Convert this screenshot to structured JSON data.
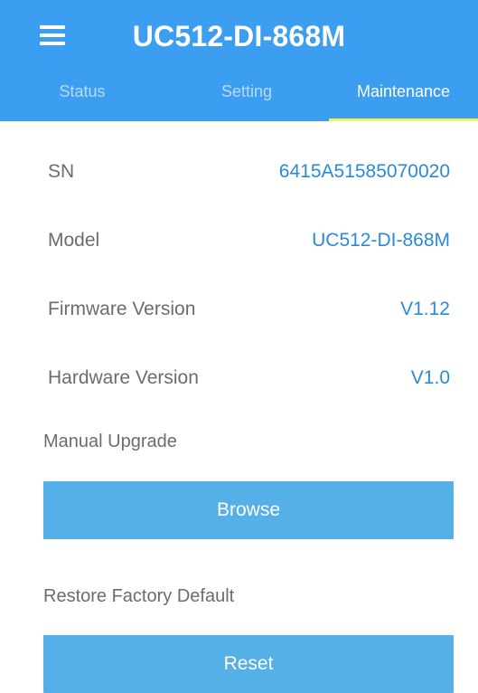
{
  "header": {
    "title": "UC512-DI-868M",
    "menu_icon": "hamburger-menu-icon",
    "background_color": "#3b9ef0"
  },
  "tabs": [
    {
      "label": "Status",
      "active": false
    },
    {
      "label": "Setting",
      "active": false
    },
    {
      "label": "Maintenance",
      "active": true
    }
  ],
  "tab_indicator_color": "#f6ef58",
  "info": [
    {
      "label": "SN",
      "value": "6415A51585070020"
    },
    {
      "label": "Model",
      "value": "UC512-DI-868M"
    },
    {
      "label": "Firmware Version",
      "value": "V1.12"
    },
    {
      "label": "Hardware Version",
      "value": "V1.0"
    }
  ],
  "manual_upgrade": {
    "label": "Manual Upgrade",
    "button_label": "Browse"
  },
  "restore": {
    "label": "Restore Factory Default",
    "button_label": "Reset"
  },
  "accent_color": "#2a8ad7",
  "button_color": "#55b0e8"
}
